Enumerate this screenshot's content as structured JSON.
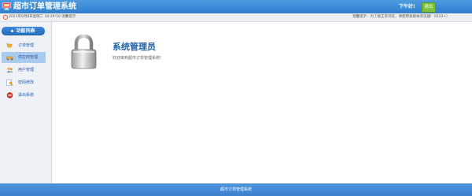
{
  "header": {
    "logo_icon": "monitor-computer-icon",
    "title": "超市订单管理系统",
    "greeting": "下午好!",
    "logout_label": "退出",
    "brand_color": "#2f7fd0",
    "logout_color": "#7ec23a"
  },
  "infobar": {
    "clock_icon": "clock-icon",
    "datetime": "2021年6月8日星期二 10:29:50 温馨提示",
    "tip": "温馨提示：为了能正常浏览，请使用高版本浏览器!（IE10+）"
  },
  "sidebar": {
    "title": "功能列表",
    "items": [
      {
        "label": "订单管理",
        "icon": "order-icon",
        "active": false
      },
      {
        "label": "供应商管理",
        "icon": "supplier-icon",
        "active": true
      },
      {
        "label": "用户管理",
        "icon": "users-icon",
        "active": false
      },
      {
        "label": "密码修改",
        "icon": "password-key-icon",
        "active": false
      },
      {
        "label": "退出系统",
        "icon": "exit-icon",
        "active": false
      }
    ]
  },
  "main": {
    "lock_icon": "padlock-icon",
    "title": "系统管理员",
    "welcome": "欢迎来到超市订单管理系统!"
  },
  "footer": {
    "text": "超市订单管理系统"
  }
}
